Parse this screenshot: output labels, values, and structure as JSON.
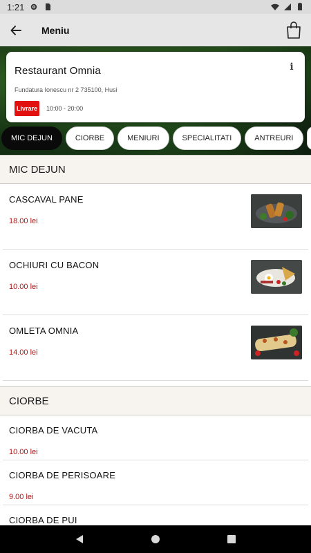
{
  "status_bar": {
    "time": "1:21"
  },
  "app_bar": {
    "title": "Meniu"
  },
  "restaurant": {
    "name": "Restaurant Omnia",
    "address": "Fundatura Ionescu nr 2 735100, Husi",
    "delivery_label": "Livrare",
    "hours": "10:00 - 20:00"
  },
  "tabs": [
    {
      "label": "MIC DEJUN",
      "active": true
    },
    {
      "label": "CIORBE"
    },
    {
      "label": "MENIURI"
    },
    {
      "label": "SPECIALITATI"
    },
    {
      "label": "ANTREURI"
    }
  ],
  "menu": {
    "sections": [
      {
        "title": "MIC DEJUN",
        "items": [
          {
            "name": "CASCAVAL PANE",
            "price": "18.00 lei"
          },
          {
            "name": "OCHIURI CU BACON",
            "price": "10.00 lei"
          },
          {
            "name": "OMLETA OMNIA",
            "price": "14.00 lei"
          }
        ]
      },
      {
        "title": "CIORBE",
        "items": [
          {
            "name": "CIORBA DE VACUTA",
            "price": "10.00 lei"
          },
          {
            "name": "CIORBA DE PERISOARE",
            "price": "9.00 lei"
          },
          {
            "name": "CIORBA DE PUI"
          }
        ]
      }
    ]
  },
  "colors": {
    "accent": "#e31010",
    "price": "#b01515",
    "active_tab": "#0a0a0a",
    "section_bg": "#f7f4f0"
  }
}
